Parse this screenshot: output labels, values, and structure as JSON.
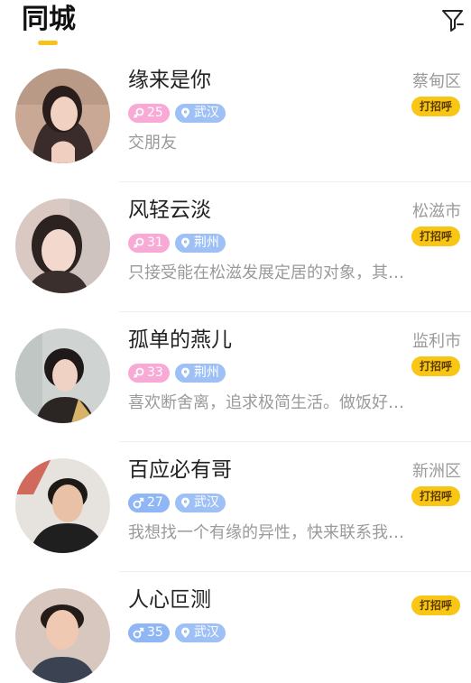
{
  "header": {
    "title": "同城",
    "accent_color": "#f6c21b",
    "filter_icon": "filter-icon"
  },
  "users": [
    {
      "name": "缘来是你",
      "gender": "female",
      "age": "25",
      "city": "武汉",
      "bio": "交朋友",
      "district": "蔡甸区",
      "greet_label": "打招呼"
    },
    {
      "name": "风轻云淡",
      "gender": "female",
      "age": "31",
      "city": "荆州",
      "bio": "只接受能在松滋发展定居的对象，其…",
      "district": "松滋市",
      "greet_label": "打招呼"
    },
    {
      "name": "孤单的燕儿",
      "gender": "female",
      "age": "33",
      "city": "荆州",
      "bio": "喜欢断舍离，追求极简生活。做饭好…",
      "district": "监利市",
      "greet_label": "打招呼"
    },
    {
      "name": "百应必有哥",
      "gender": "male",
      "age": "27",
      "city": "武汉",
      "bio": "我想找一个有缘的异性，快来联系我…",
      "district": "新洲区",
      "greet_label": "打招呼"
    },
    {
      "name": "人心叵测",
      "gender": "male",
      "age": "35",
      "city": "武汉",
      "bio": "",
      "district": "",
      "greet_label": "打招呼"
    }
  ]
}
